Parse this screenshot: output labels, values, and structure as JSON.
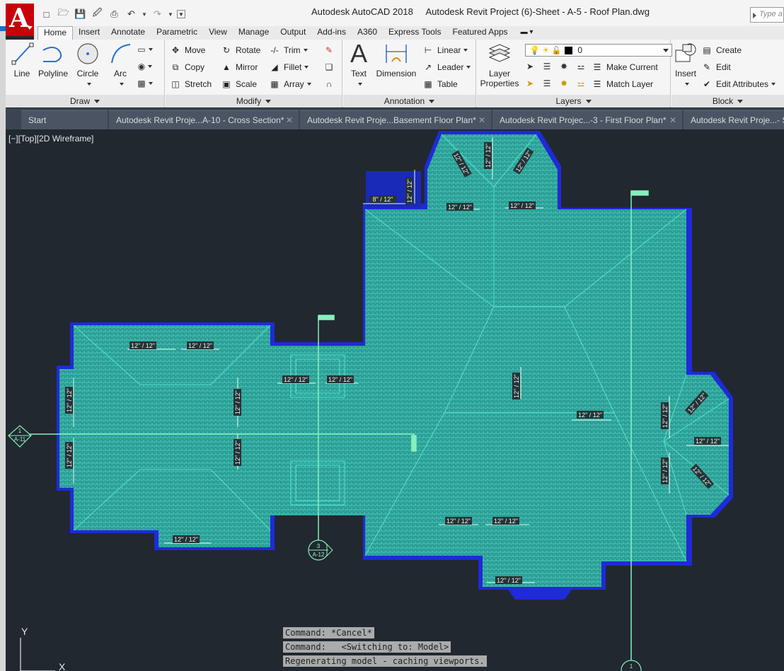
{
  "titlebar": {
    "app_button_letter": "A",
    "app_name": "Autodesk AutoCAD 2018",
    "document_title": "Autodesk Revit Project  (6)-Sheet - A-5 - Roof Plan.dwg",
    "search_placeholder": "Type a"
  },
  "ribbon_tabs": [
    "Home",
    "Insert",
    "Annotate",
    "Parametric",
    "View",
    "Manage",
    "Output",
    "Add-ins",
    "A360",
    "Express Tools",
    "Featured Apps"
  ],
  "ribbon": {
    "draw": {
      "title": "Draw",
      "buttons": [
        "Line",
        "Polyline",
        "Circle",
        "Arc"
      ]
    },
    "modify": {
      "title": "Modify",
      "buttons": [
        "Move",
        "Rotate",
        "Trim",
        "Copy",
        "Mirror",
        "Fillet",
        "Stretch",
        "Scale",
        "Array"
      ]
    },
    "annotation": {
      "title": "Annotation",
      "text": "Text",
      "dimension": "Dimension",
      "linear": "Linear",
      "leader": "Leader",
      "table": "Table"
    },
    "layers": {
      "title": "Layers",
      "layer_properties": [
        "Layer",
        "Properties"
      ],
      "current_layer": "0",
      "make_current": "Make Current",
      "match_layer": "Match Layer"
    },
    "block": {
      "title": "Block",
      "insert": "Insert",
      "create": "Create",
      "edit": "Edit",
      "edit_attributes": "Edit Attributes"
    }
  },
  "file_tabs": [
    "Start",
    "Autodesk Revit Proje...A-10 - Cross Section*",
    "Autodesk Revit Proje...Basement Floor Plan*",
    "Autodesk Revit Projec...-3 - First Floor Plan*",
    "Autodesk Revit Proje...- Se"
  ],
  "viewport_label": "[−][Top][2D Wireframe]",
  "drawing": {
    "slope_tags": {
      "t12": "12\" / 12\"",
      "t8": "8\" / 12\""
    },
    "section_markers": [
      {
        "number": "1",
        "sheet": "A-11"
      },
      {
        "number": "3",
        "sheet": "A-12"
      },
      {
        "number": "1"
      }
    ],
    "ucs": {
      "y": "Y",
      "x": "X"
    }
  },
  "command_history": [
    "Command: *Cancel*",
    "Command:   <Switching to: Model>",
    "Regenerating model - caching viewports."
  ],
  "colors": {
    "roof_outline": "#1a26d6",
    "roof_fill": "#2aa69b",
    "roof_lines": "#4fe0c4",
    "section_line": "#86f0bc",
    "background": "#212830"
  }
}
